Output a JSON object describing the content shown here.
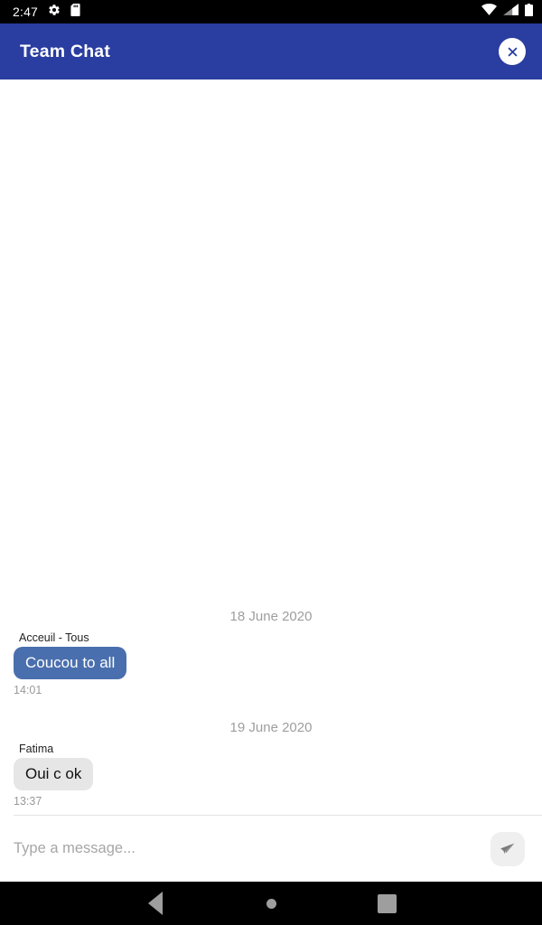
{
  "status_bar": {
    "clock": "2:47",
    "left_icons": [
      "gear-icon",
      "sd-card-icon"
    ],
    "right_icons": [
      "wifi-icon",
      "cellular-signal-icon",
      "battery-icon"
    ]
  },
  "app_bar": {
    "title": "Team Chat",
    "close_icon": "close-icon",
    "background_color": "#2a3da0"
  },
  "conversation": {
    "groups": [
      {
        "date": "18 June 2020",
        "messages": [
          {
            "sender": "Acceuil - Tous",
            "text": "Coucou to all",
            "time": "14:01",
            "bubble_color": "#4a6fae",
            "text_color": "#ffffff"
          }
        ]
      },
      {
        "date": "19 June 2020",
        "messages": [
          {
            "sender": "Fatima",
            "text": "Oui c ok",
            "time": "13:37",
            "bubble_color": "#e6e6e6",
            "text_color": "#111111"
          }
        ]
      }
    ]
  },
  "composer": {
    "placeholder": "Type a message...",
    "value": "",
    "send_icon": "send-paper-plane-icon"
  },
  "nav_bar": {
    "back_label": "Back",
    "home_label": "Home",
    "recents_label": "Recents"
  }
}
